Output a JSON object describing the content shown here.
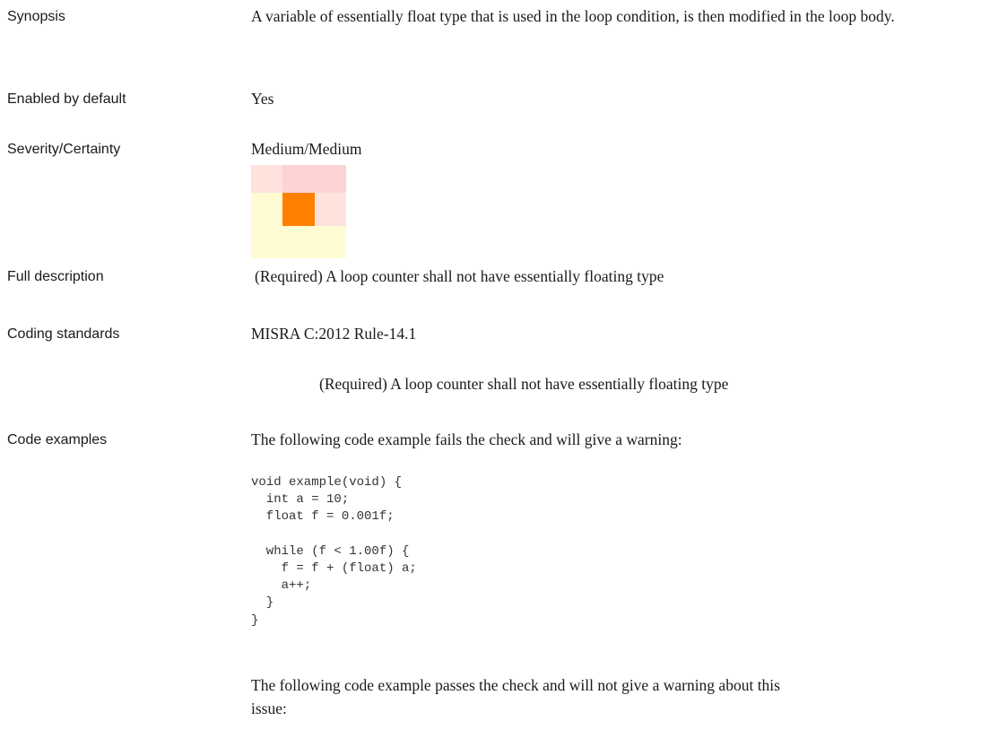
{
  "synopsis": {
    "label": "Synopsis",
    "text": "A variable of essentially float type that is used in the loop condition, is then modified in the loop body."
  },
  "enabled_by_default": {
    "label": "Enabled by default",
    "value": "Yes"
  },
  "severity_certainty": {
    "label": "Severity/Certainty",
    "value": "Medium/Medium",
    "matrix_colors": [
      [
        "#fde3db",
        "#fdd3d6",
        "#fdd3d6"
      ],
      [
        "#fffcd3",
        "#ff8000",
        "#fde3db"
      ],
      [
        "#fffcd3",
        "#fffcd3",
        "#fffcd3"
      ]
    ]
  },
  "full_description": {
    "label": "Full description",
    "text": "(Required) A loop counter shall not have essentially floating type"
  },
  "coding_standards": {
    "label": "Coding standards",
    "standard": "MISRA C:2012 Rule-14.1",
    "rule_text": "(Required) A loop counter shall not have essentially floating type"
  },
  "code_examples": {
    "label": "Code examples",
    "fail_intro": "The following code example fails the check and will give a warning:",
    "fail_code": [
      "void example(void) {",
      "  int a = 10;",
      "  float f = 0.001f;",
      "",
      "  while (f < 1.00f) {",
      "    f = f + (float) a;",
      "    a++;",
      "  }",
      "}"
    ],
    "pass_intro_line1": "The following code example passes the check and will not give a warning about this",
    "pass_intro_line2": "issue:"
  }
}
